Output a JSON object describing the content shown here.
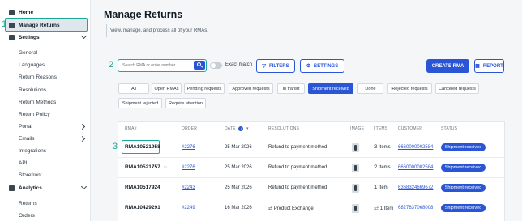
{
  "sidebar": {
    "home": "Home",
    "manage_returns": "Manage Returns",
    "settings": "Settings",
    "settings_items": [
      "General",
      "Languages",
      "Return Reasons",
      "Resolutions",
      "Return Methods",
      "Return Policy",
      "Portal",
      "Emails",
      "Integrations",
      "API",
      "Storefront"
    ],
    "analytics": "Analytics",
    "analytics_items": [
      "Returns",
      "Orders"
    ]
  },
  "callouts": [
    "1",
    "2",
    "3"
  ],
  "header": {
    "title": "Manage Returns",
    "subtitle": "View, manage, and process all of your RMAs."
  },
  "toolbar": {
    "search_placeholder": "Search RMA or order number",
    "exact_match": "Exact match",
    "filters": "FILTERS",
    "settings": "SETTINGS",
    "create_rma": "CREATE RMA",
    "report": "REPORT"
  },
  "tabs": [
    "All",
    "Open RMAs",
    "Pending requests",
    "Approved requests",
    "In transit",
    "Shipment received",
    "Done",
    "Rejected requests",
    "Canceled requests",
    "Shipment rejected",
    "Require attention"
  ],
  "active_tab": "Shipment received",
  "table": {
    "headers": [
      "RMA#",
      "ORDER",
      "DATE",
      "RESOLUTIONS",
      "IMAGE",
      "ITEMS",
      "CUSTOMER",
      "STATUS"
    ],
    "rows": [
      {
        "rma": "RMA10521958",
        "order": "#2276",
        "date": "25 Mar 2026",
        "resolution": "Refund to payment method",
        "items": "3 Items",
        "customer": "6660000002584",
        "status": "Shipment received"
      },
      {
        "rma": "RMA10521757",
        "order": "#2276",
        "date": "25 Mar 2026",
        "resolution": "Refund to payment method",
        "items": "2 Items",
        "customer": "6660000002584",
        "status": "Shipment received"
      },
      {
        "rma": "RMA10517924",
        "order": "#2243",
        "date": "25 Mar 2026",
        "resolution": "Refund to payment method",
        "items": "1 Item",
        "customer": "6368324669672",
        "status": "Shipment received"
      },
      {
        "rma": "RMA10429291",
        "order": "#2249",
        "date": "16 Mar 2026",
        "resolution": "Product Exchange",
        "items": "1 Item",
        "customer": "6827637068008",
        "status": "Shipment received"
      }
    ]
  },
  "colors": {
    "accent": "#2a56d6",
    "callout": "#1aa89a"
  }
}
